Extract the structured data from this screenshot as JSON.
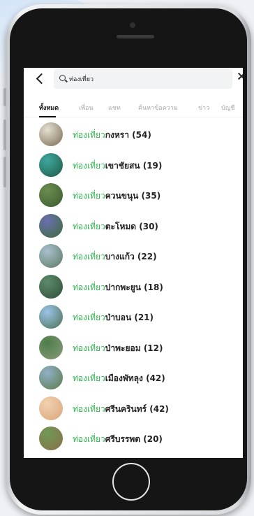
{
  "search": {
    "query": "ท่องเที่ยว"
  },
  "tabs": [
    {
      "label": "ทั้งหมด",
      "active": true
    },
    {
      "label": "เพื่อน",
      "active": false
    },
    {
      "label": "แชท",
      "active": false
    },
    {
      "label": "ค้นหาข้อความ",
      "active": false
    },
    {
      "label": "ข่าว",
      "active": false
    },
    {
      "label": "บัญชี",
      "active": false
    }
  ],
  "results": [
    {
      "prefix": "ท่องเที่ยว",
      "name": "กงหรา",
      "count": "(54)",
      "avatar_colors": [
        "#e4e0d4",
        "#7b6a4f"
      ]
    },
    {
      "prefix": "ท่องเที่ยว",
      "name": "เขาชัยสน",
      "count": "(19)",
      "avatar_colors": [
        "#3fa7a0",
        "#1f5a44"
      ]
    },
    {
      "prefix": "ท่องเที่ยว",
      "name": "ควนขนุน",
      "count": "(35)",
      "avatar_colors": [
        "#6b8d4f",
        "#3b5a31"
      ]
    },
    {
      "prefix": "ท่องเที่ยว",
      "name": "ตะโหมด",
      "count": "(30)",
      "avatar_colors": [
        "#6a6fb0",
        "#3e6b3a"
      ]
    },
    {
      "prefix": "ท่องเที่ยว",
      "name": "บางแก้ว",
      "count": "(22)",
      "avatar_colors": [
        "#a9c0cf",
        "#5c7a62"
      ]
    },
    {
      "prefix": "ท่องเที่ยว",
      "name": "ปากพะยูน",
      "count": "(18)",
      "avatar_colors": [
        "#5d8a6a",
        "#2e4f3a"
      ]
    },
    {
      "prefix": "ท่องเที่ยว",
      "name": "ป่าบอน",
      "count": "(21)",
      "avatar_colors": [
        "#9cc4e8",
        "#4a6f52"
      ]
    },
    {
      "prefix": "ท่องเที่ยว",
      "name": "ป่าพะยอม",
      "count": "(12)",
      "avatar_colors": [
        "#4e7d4a",
        "#8a9a7a"
      ]
    },
    {
      "prefix": "ท่องเที่ยว",
      "name": "เมืองพัทลุง",
      "count": "(42)",
      "avatar_colors": [
        "#8fb0c8",
        "#5d7a48"
      ]
    },
    {
      "prefix": "ท่องเที่ยว",
      "name": "ศรีนครินทร์",
      "count": "(42)",
      "avatar_colors": [
        "#f2d2b0",
        "#d9a57a"
      ]
    },
    {
      "prefix": "ท่องเที่ยว",
      "name": "ศรีบรรพต",
      "count": "(20)",
      "avatar_colors": [
        "#6f9a55",
        "#8a6e4a"
      ]
    }
  ]
}
